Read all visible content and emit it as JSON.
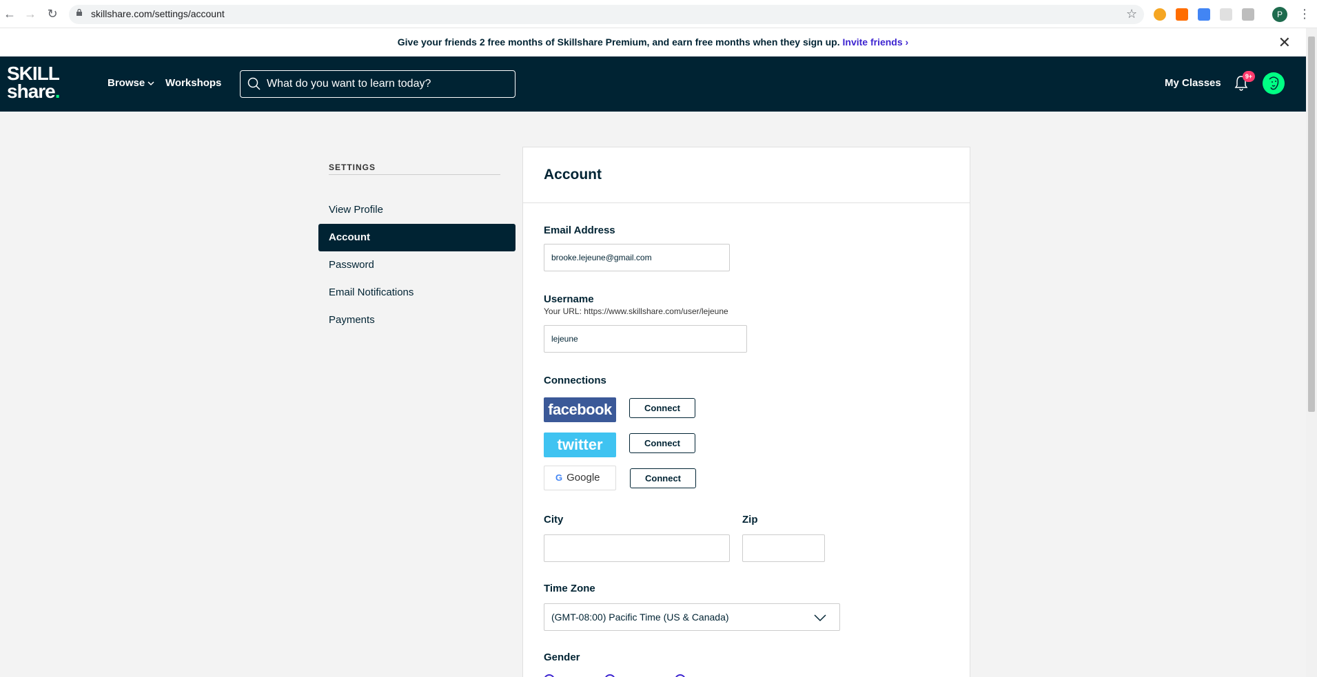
{
  "browser": {
    "url": "skillshare.com/settings/account",
    "profile_initial": "P"
  },
  "promo": {
    "text": "Give your friends 2 free months of Skillshare Premium, and earn free months when they sign up.",
    "link": "Invite friends"
  },
  "header": {
    "logo_line1": "SKILL",
    "logo_line2": "share",
    "logo_dot": ".",
    "browse": "Browse",
    "workshops": "Workshops",
    "search_placeholder": "What do you want to learn today?",
    "my_classes": "My Classes",
    "notification_count": "9+"
  },
  "sidebar": {
    "heading": "SETTINGS",
    "items": [
      {
        "label": "View Profile"
      },
      {
        "label": "Account"
      },
      {
        "label": "Password"
      },
      {
        "label": "Email Notifications"
      },
      {
        "label": "Payments"
      }
    ]
  },
  "account": {
    "title": "Account",
    "email_label": "Email Address",
    "email_value": "brooke.lejeune@gmail.com",
    "username_label": "Username",
    "username_url": "Your URL: https://www.skillshare.com/user/lejeune",
    "username_value": "lejeune",
    "connections_label": "Connections",
    "facebook": "facebook",
    "twitter": "twitter",
    "google": "Google",
    "connect_label": "Connect",
    "city_label": "City",
    "city_value": "",
    "zip_label": "Zip",
    "zip_value": "",
    "timezone_label": "Time Zone",
    "timezone_value": "(GMT-08:00) Pacific Time (US & Canada)",
    "gender_label": "Gender"
  },
  "colors": {
    "brand_dark": "#002333",
    "brand_green": "#00ff84",
    "link_purple": "#3d24d0",
    "facebook_blue": "#3b5998",
    "twitter_blue": "#3fc3f1"
  }
}
